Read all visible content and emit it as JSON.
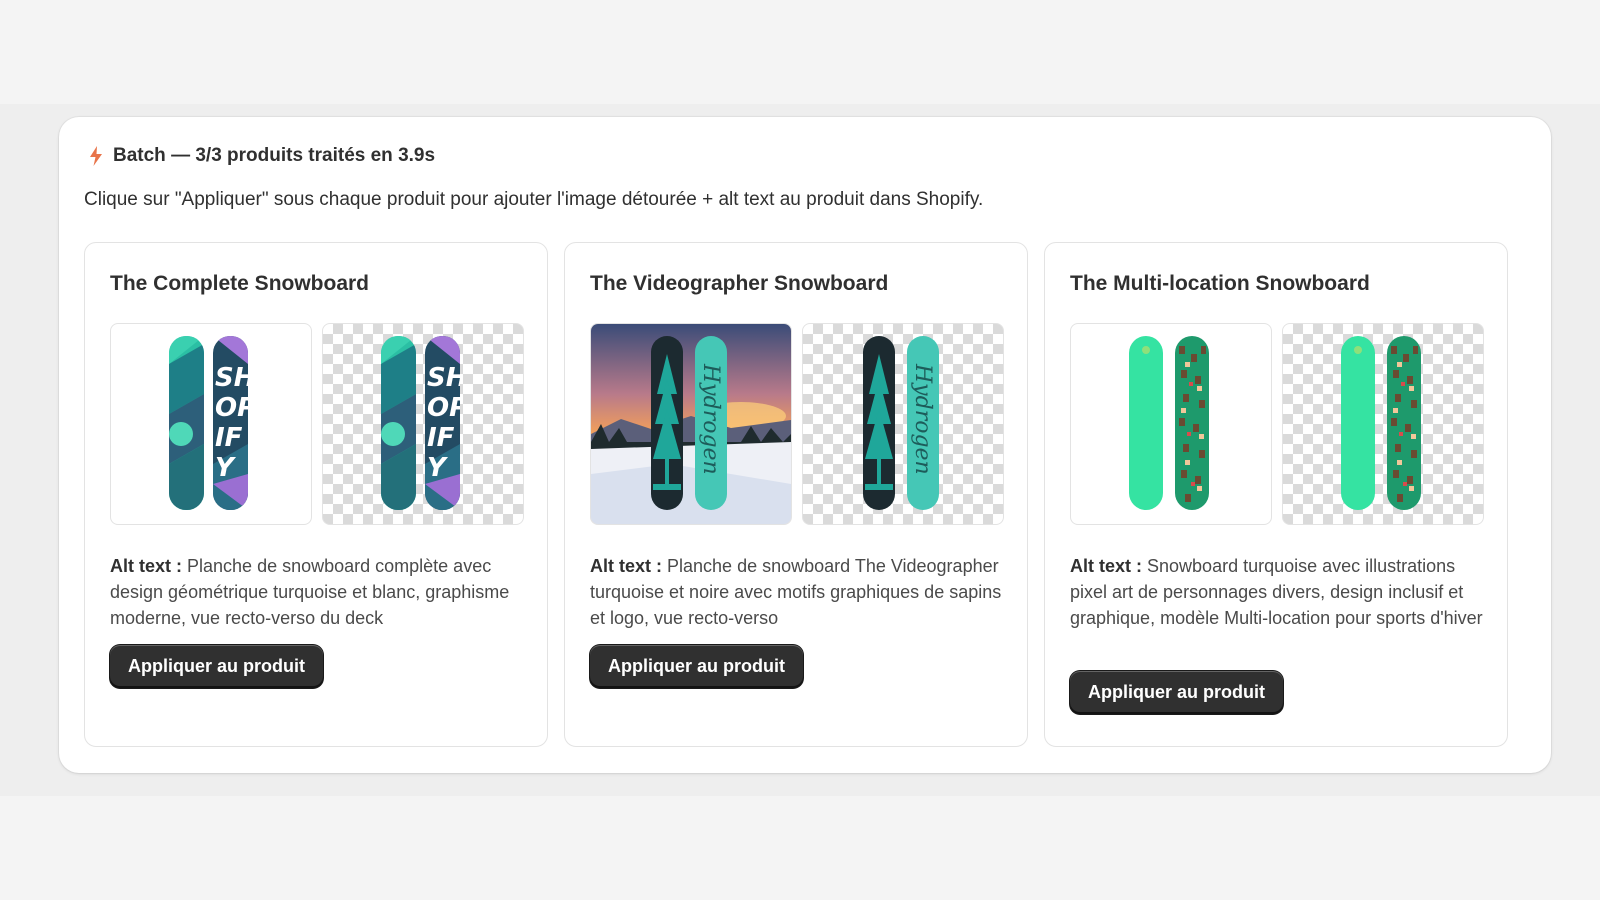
{
  "batch": {
    "title": "Batch — 3/3 produits traités en 3.9s",
    "description": "Clique sur \"Appliquer\" sous chaque produit pour ajouter l'image détourée + alt text au produit dans Shopify.",
    "icon": "lightning-icon",
    "accent": "#e8744a"
  },
  "products": [
    {
      "title": "The Complete Snowboard",
      "alt_label": "Alt text :",
      "alt_text": "Planche de snowboard complète avec design géométrique turquoise et blanc, graphisme moderne, vue recto-verso du deck",
      "button_label": "Appliquer au produit"
    },
    {
      "title": "The Videographer Snowboard",
      "alt_label": "Alt text :",
      "alt_text": "Planche de snowboard The Videographer turquoise et noire avec motifs graphiques de sapins et logo, vue recto-verso",
      "button_label": "Appliquer au produit"
    },
    {
      "title": "The Multi-location Snowboard",
      "alt_label": "Alt text :",
      "alt_text": "Snowboard turquoise avec illustrations pixel art de personnages divers, design inclusif et graphique, modèle Multi-location pour sports d'hiver",
      "button_label": "Appliquer au produit"
    }
  ],
  "board_graphics": {
    "complete": "SHOPIFY",
    "videographer": "Hydrogen"
  }
}
